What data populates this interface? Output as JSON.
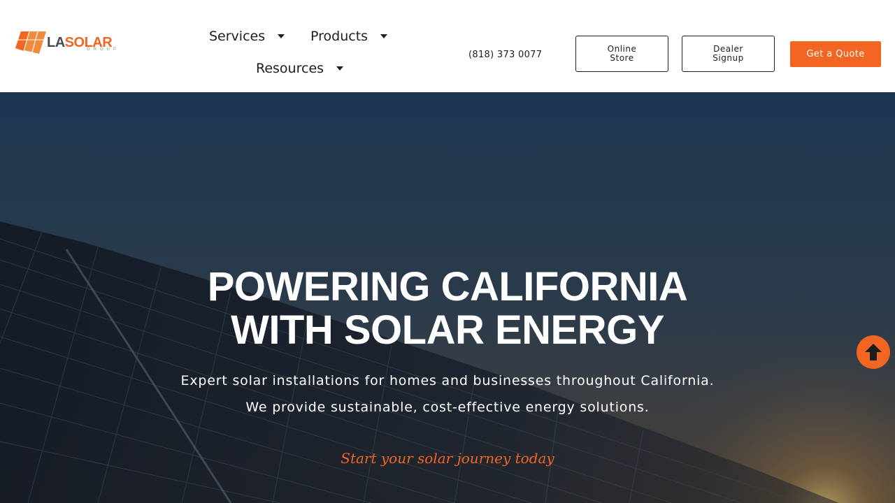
{
  "brand": {
    "logo_primary": "LA",
    "logo_secondary": "SOLAR",
    "logo_sub": "GROUP",
    "accent_color": "#f26522",
    "text_color": "#1d1d1d"
  },
  "nav": {
    "services": "Services",
    "products": "Products",
    "resources": "Resources"
  },
  "header": {
    "phone": "(818) 373 0077",
    "online_store": "Online Store",
    "dealer_signup": "Dealer Signup",
    "get_quote": "Get a Quote"
  },
  "hero": {
    "title_line1": "POWERING CALIFORNIA",
    "title_line2": "WITH SOLAR ENERGY",
    "subtitle_line1": "Expert solar installations for homes and businesses throughout California.",
    "subtitle_line2": "We provide sustainable, cost-effective energy solutions.",
    "tagline": "Start your solar journey today"
  },
  "icons": {
    "caret": "caret-down-icon",
    "scroll_top": "arrow-up-icon"
  }
}
